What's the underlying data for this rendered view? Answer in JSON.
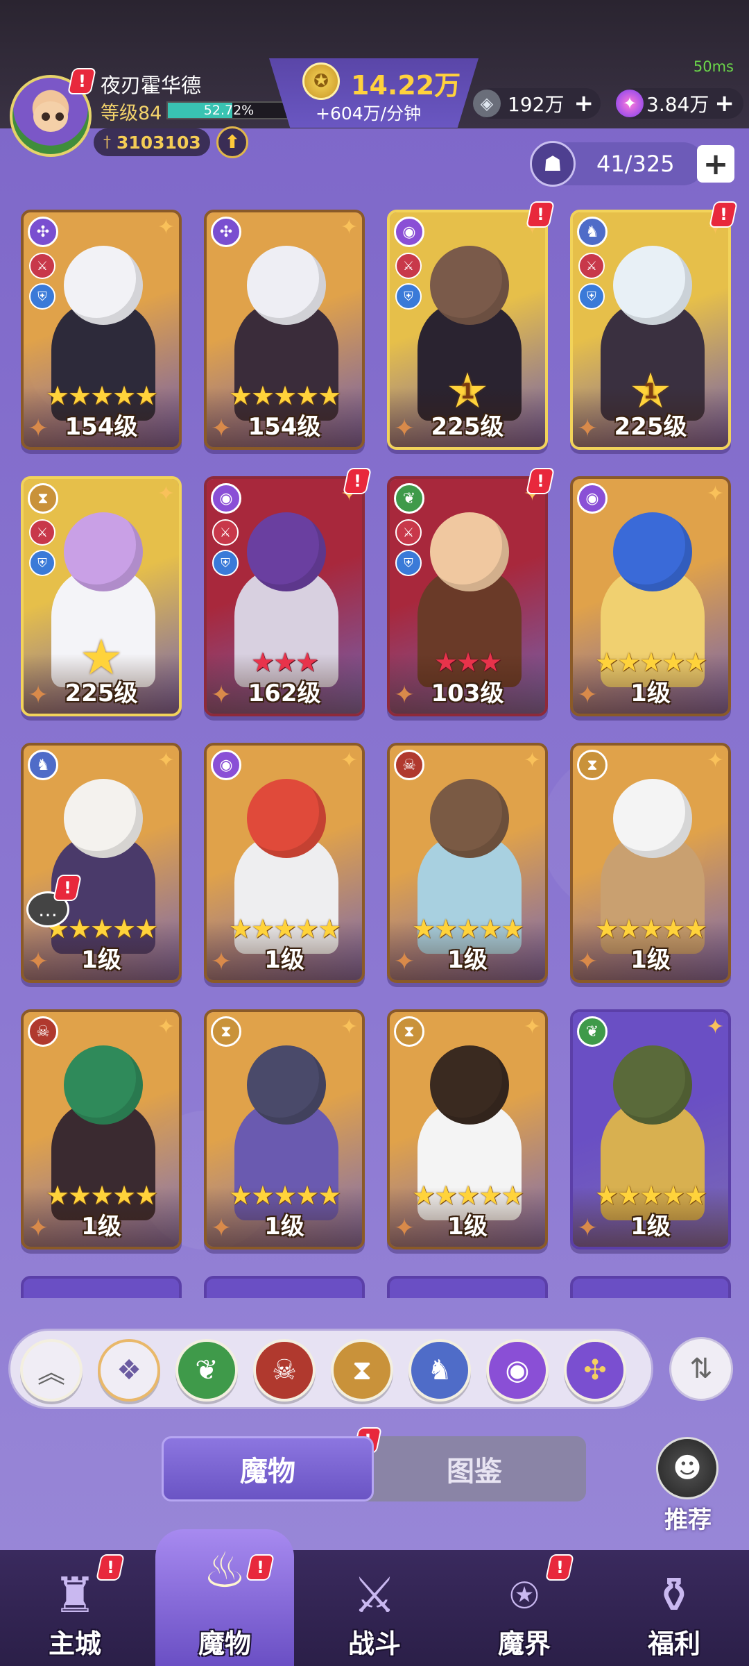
{
  "status": {
    "ping": "50ms"
  },
  "player": {
    "name": "夜刃霍华德",
    "level_label": "等级84",
    "exp_percent_text": "52.72%",
    "exp_fraction": 0.5272,
    "power": "3103103"
  },
  "currency": {
    "gold_amount": "14.22万",
    "gold_rate": "+604万/分钟",
    "gem_amount": "192万",
    "star_amount": "3.84万"
  },
  "roster": {
    "count_text": "41/325"
  },
  "badge_mark": "!",
  "cards": [
    {
      "level": "154级",
      "stars": "★★★★★",
      "style": "normal",
      "faction_icon": "shuriken-icon",
      "alert": false
    },
    {
      "level": "154级",
      "stars": "★★★★★",
      "style": "normal",
      "faction_icon": "shuriken-icon",
      "alert": false
    },
    {
      "level": "225级",
      "big_star": "1",
      "style": "gold",
      "faction_icon": "eye-icon",
      "alert": true
    },
    {
      "level": "225级",
      "big_star": "1",
      "style": "gold",
      "faction_icon": "dragon-icon",
      "alert": true
    },
    {
      "level": "225级",
      "big_star": "",
      "style": "gold",
      "faction_icon": "hourglass-icon",
      "alert": false
    },
    {
      "level": "162级",
      "stars": "★★★",
      "style": "red",
      "faction_icon": "eye-icon",
      "alert": true
    },
    {
      "level": "103级",
      "stars": "★★★",
      "style": "red",
      "faction_icon": "leaf-icon",
      "alert": true
    },
    {
      "level": "1级",
      "stars": "★★★★★",
      "style": "normal",
      "faction_icon": "eye-icon",
      "alert": false
    },
    {
      "level": "1级",
      "stars": "★★★★★",
      "style": "normal",
      "faction_icon": "dragon-icon",
      "alert": false
    },
    {
      "level": "1级",
      "stars": "★★★★★",
      "style": "normal",
      "faction_icon": "eye-icon",
      "alert": false
    },
    {
      "level": "1级",
      "stars": "★★★★★",
      "style": "normal",
      "faction_icon": "demon-icon",
      "alert": false
    },
    {
      "level": "1级",
      "stars": "★★★★★",
      "style": "normal",
      "faction_icon": "hourglass-icon",
      "alert": false
    },
    {
      "level": "1级",
      "stars": "★★★★★",
      "style": "normal",
      "faction_icon": "demon-icon",
      "alert": false
    },
    {
      "level": "1级",
      "stars": "★★★★★",
      "style": "normal",
      "faction_icon": "hourglass-icon",
      "alert": false
    },
    {
      "level": "1级",
      "stars": "★★★★★",
      "style": "normal",
      "faction_icon": "hourglass-icon",
      "alert": false
    },
    {
      "level": "1级",
      "stars": "★★★★★",
      "style": "purple",
      "faction_icon": "leaf-icon",
      "alert": false
    }
  ],
  "filters": [
    {
      "icon": "collapse-icon",
      "label": ""
    },
    {
      "icon": "all-icon",
      "label": ""
    },
    {
      "icon": "leaf-icon",
      "label": ""
    },
    {
      "icon": "demon-icon",
      "label": ""
    },
    {
      "icon": "hourglass-icon",
      "label": ""
    },
    {
      "icon": "dragon-icon",
      "label": ""
    },
    {
      "icon": "eye-icon",
      "label": ""
    },
    {
      "icon": "shuriken-icon",
      "label": ""
    }
  ],
  "tabs": {
    "monsters": "魔物",
    "codex": "图鉴"
  },
  "recommend": {
    "label": "推荐"
  },
  "nav": [
    {
      "label": "主城",
      "icon": "castle-icon"
    },
    {
      "label": "魔物",
      "icon": "flame-icon"
    },
    {
      "label": "战斗",
      "icon": "sword-shield-icon"
    },
    {
      "label": "魔界",
      "icon": "portal-icon"
    },
    {
      "label": "福利",
      "icon": "treasure-chest-icon"
    }
  ],
  "colors": {
    "accent": "#7a63c4",
    "gold_text": "#ffd23d",
    "exp_fill": "#39c3b2",
    "alert_red": "#e8283c"
  }
}
